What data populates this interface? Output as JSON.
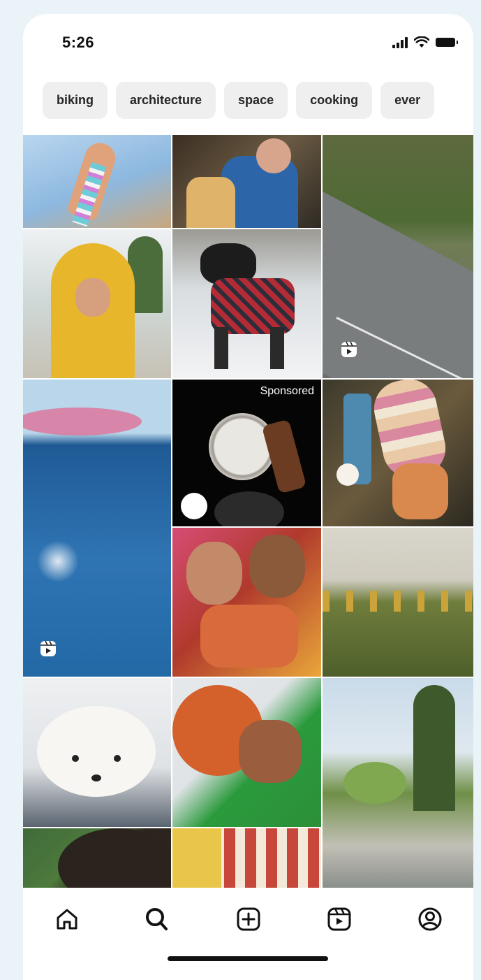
{
  "status_bar": {
    "time": "5:26",
    "icons": [
      "cellular-signal-icon",
      "wifi-icon",
      "battery-icon"
    ]
  },
  "chips": [
    {
      "label": "biking"
    },
    {
      "label": "architecture"
    },
    {
      "label": "space"
    },
    {
      "label": "cooking"
    },
    {
      "label": "ever"
    }
  ],
  "grid": {
    "tiles": [
      {
        "name": "photo-hand-kite"
      },
      {
        "name": "photo-people-overalls"
      },
      {
        "name": "reel-road-forest",
        "badge": "reels-icon"
      },
      {
        "name": "photo-yellow-raincoat"
      },
      {
        "name": "photo-dog-plaid-coat"
      },
      {
        "name": "reel-ocean-swimmer",
        "badge": "reels-icon"
      },
      {
        "name": "ad-watch",
        "sponsored_label": "Sponsored"
      },
      {
        "name": "photo-ice-cream"
      },
      {
        "name": "photo-friends-peace"
      },
      {
        "name": "photo-sunflowers"
      },
      {
        "name": "photo-white-dog"
      },
      {
        "name": "photo-basketball"
      },
      {
        "name": "photo-garden-trees"
      },
      {
        "name": "photo-curly-hair"
      },
      {
        "name": "photo-striped-awning"
      }
    ]
  },
  "bottom_nav": {
    "items": [
      {
        "icon": "home-icon"
      },
      {
        "icon": "search-icon"
      },
      {
        "icon": "create-post-icon"
      },
      {
        "icon": "reels-icon"
      },
      {
        "icon": "profile-icon"
      }
    ]
  },
  "colors": {
    "background": "#eaf3f8",
    "chip_background": "#efefef",
    "text": "#262626"
  }
}
